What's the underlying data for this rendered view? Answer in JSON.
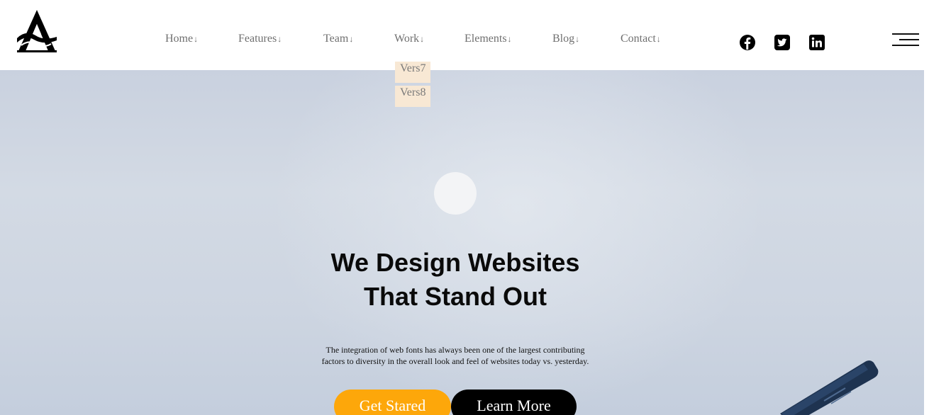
{
  "brand": {
    "logo_icon": "a-letter-logo-icon"
  },
  "nav": {
    "items": [
      {
        "label": "Home",
        "arrow": "↓"
      },
      {
        "label": "Features",
        "arrow": "↓"
      },
      {
        "label": "Team",
        "arrow": "↓"
      },
      {
        "label": "Work",
        "arrow": "↓"
      },
      {
        "label": "Elements",
        "arrow": "↓"
      },
      {
        "label": "Blog",
        "arrow": "↓"
      },
      {
        "label": "Contact",
        "arrow": "↓"
      }
    ],
    "dropdown": [
      "Vers7",
      "Vers8"
    ]
  },
  "social": {
    "icons": [
      "facebook-icon",
      "twitter-icon",
      "linkedin-icon"
    ]
  },
  "hero": {
    "headline_line1": "We Design Websites",
    "headline_line2": "That Stand Out",
    "description_line1": "The integration of web fonts has always been one of the largest contributing",
    "description_line2": "factors to diversity in the overall look and feel of websites today vs. yesterday.",
    "primary_button": "Get Stared",
    "secondary_button": "Learn More"
  },
  "colors": {
    "accent": "#fda70a",
    "dark": "#000000",
    "dropdown_bg": "#f8e8d4",
    "hero_bg": "#cdd5e1",
    "nav_text": "#6f6f6f"
  }
}
